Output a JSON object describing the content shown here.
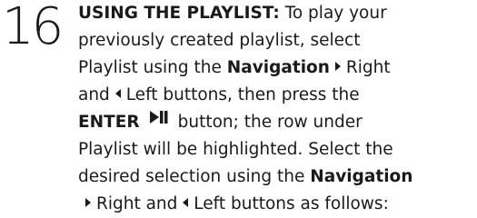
{
  "step": {
    "number": "16"
  },
  "instruction": {
    "heading": "USING THE PLAYLIST:",
    "t1": "To play your",
    "t2": "previously created playlist, select",
    "t3": "Playlist using the",
    "nav1": "Navigation",
    "t4": "Right",
    "t5": "and",
    "t6": "Left buttons, then press the",
    "enter": "ENTER",
    "t7": "button; the row under",
    "t8": "Playlist will be highlighted. Select the",
    "t9": "desired selection using the",
    "nav2": "Navigation",
    "t10": "Right and",
    "t11": "Left buttons as follows:"
  },
  "icons": {
    "right_arrow": "triangle-right-icon",
    "left_arrow": "triangle-left-icon",
    "enter": "play-pause-icon"
  }
}
